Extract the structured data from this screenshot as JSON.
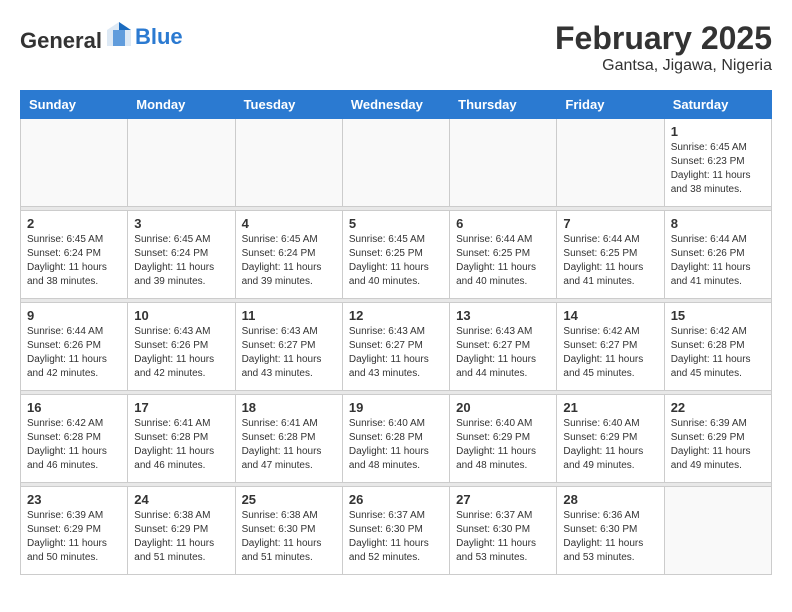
{
  "logo": {
    "line1": "General",
    "line2": "Blue"
  },
  "title": "February 2025",
  "subtitle": "Gantsa, Jigawa, Nigeria",
  "days_of_week": [
    "Sunday",
    "Monday",
    "Tuesday",
    "Wednesday",
    "Thursday",
    "Friday",
    "Saturday"
  ],
  "weeks": [
    [
      {
        "day": "",
        "info": ""
      },
      {
        "day": "",
        "info": ""
      },
      {
        "day": "",
        "info": ""
      },
      {
        "day": "",
        "info": ""
      },
      {
        "day": "",
        "info": ""
      },
      {
        "day": "",
        "info": ""
      },
      {
        "day": "1",
        "info": "Sunrise: 6:45 AM\nSunset: 6:23 PM\nDaylight: 11 hours and 38 minutes."
      }
    ],
    [
      {
        "day": "2",
        "info": "Sunrise: 6:45 AM\nSunset: 6:24 PM\nDaylight: 11 hours and 38 minutes."
      },
      {
        "day": "3",
        "info": "Sunrise: 6:45 AM\nSunset: 6:24 PM\nDaylight: 11 hours and 39 minutes."
      },
      {
        "day": "4",
        "info": "Sunrise: 6:45 AM\nSunset: 6:24 PM\nDaylight: 11 hours and 39 minutes."
      },
      {
        "day": "5",
        "info": "Sunrise: 6:45 AM\nSunset: 6:25 PM\nDaylight: 11 hours and 40 minutes."
      },
      {
        "day": "6",
        "info": "Sunrise: 6:44 AM\nSunset: 6:25 PM\nDaylight: 11 hours and 40 minutes."
      },
      {
        "day": "7",
        "info": "Sunrise: 6:44 AM\nSunset: 6:25 PM\nDaylight: 11 hours and 41 minutes."
      },
      {
        "day": "8",
        "info": "Sunrise: 6:44 AM\nSunset: 6:26 PM\nDaylight: 11 hours and 41 minutes."
      }
    ],
    [
      {
        "day": "9",
        "info": "Sunrise: 6:44 AM\nSunset: 6:26 PM\nDaylight: 11 hours and 42 minutes."
      },
      {
        "day": "10",
        "info": "Sunrise: 6:43 AM\nSunset: 6:26 PM\nDaylight: 11 hours and 42 minutes."
      },
      {
        "day": "11",
        "info": "Sunrise: 6:43 AM\nSunset: 6:27 PM\nDaylight: 11 hours and 43 minutes."
      },
      {
        "day": "12",
        "info": "Sunrise: 6:43 AM\nSunset: 6:27 PM\nDaylight: 11 hours and 43 minutes."
      },
      {
        "day": "13",
        "info": "Sunrise: 6:43 AM\nSunset: 6:27 PM\nDaylight: 11 hours and 44 minutes."
      },
      {
        "day": "14",
        "info": "Sunrise: 6:42 AM\nSunset: 6:27 PM\nDaylight: 11 hours and 45 minutes."
      },
      {
        "day": "15",
        "info": "Sunrise: 6:42 AM\nSunset: 6:28 PM\nDaylight: 11 hours and 45 minutes."
      }
    ],
    [
      {
        "day": "16",
        "info": "Sunrise: 6:42 AM\nSunset: 6:28 PM\nDaylight: 11 hours and 46 minutes."
      },
      {
        "day": "17",
        "info": "Sunrise: 6:41 AM\nSunset: 6:28 PM\nDaylight: 11 hours and 46 minutes."
      },
      {
        "day": "18",
        "info": "Sunrise: 6:41 AM\nSunset: 6:28 PM\nDaylight: 11 hours and 47 minutes."
      },
      {
        "day": "19",
        "info": "Sunrise: 6:40 AM\nSunset: 6:28 PM\nDaylight: 11 hours and 48 minutes."
      },
      {
        "day": "20",
        "info": "Sunrise: 6:40 AM\nSunset: 6:29 PM\nDaylight: 11 hours and 48 minutes."
      },
      {
        "day": "21",
        "info": "Sunrise: 6:40 AM\nSunset: 6:29 PM\nDaylight: 11 hours and 49 minutes."
      },
      {
        "day": "22",
        "info": "Sunrise: 6:39 AM\nSunset: 6:29 PM\nDaylight: 11 hours and 49 minutes."
      }
    ],
    [
      {
        "day": "23",
        "info": "Sunrise: 6:39 AM\nSunset: 6:29 PM\nDaylight: 11 hours and 50 minutes."
      },
      {
        "day": "24",
        "info": "Sunrise: 6:38 AM\nSunset: 6:29 PM\nDaylight: 11 hours and 51 minutes."
      },
      {
        "day": "25",
        "info": "Sunrise: 6:38 AM\nSunset: 6:30 PM\nDaylight: 11 hours and 51 minutes."
      },
      {
        "day": "26",
        "info": "Sunrise: 6:37 AM\nSunset: 6:30 PM\nDaylight: 11 hours and 52 minutes."
      },
      {
        "day": "27",
        "info": "Sunrise: 6:37 AM\nSunset: 6:30 PM\nDaylight: 11 hours and 53 minutes."
      },
      {
        "day": "28",
        "info": "Sunrise: 6:36 AM\nSunset: 6:30 PM\nDaylight: 11 hours and 53 minutes."
      },
      {
        "day": "",
        "info": ""
      }
    ]
  ]
}
